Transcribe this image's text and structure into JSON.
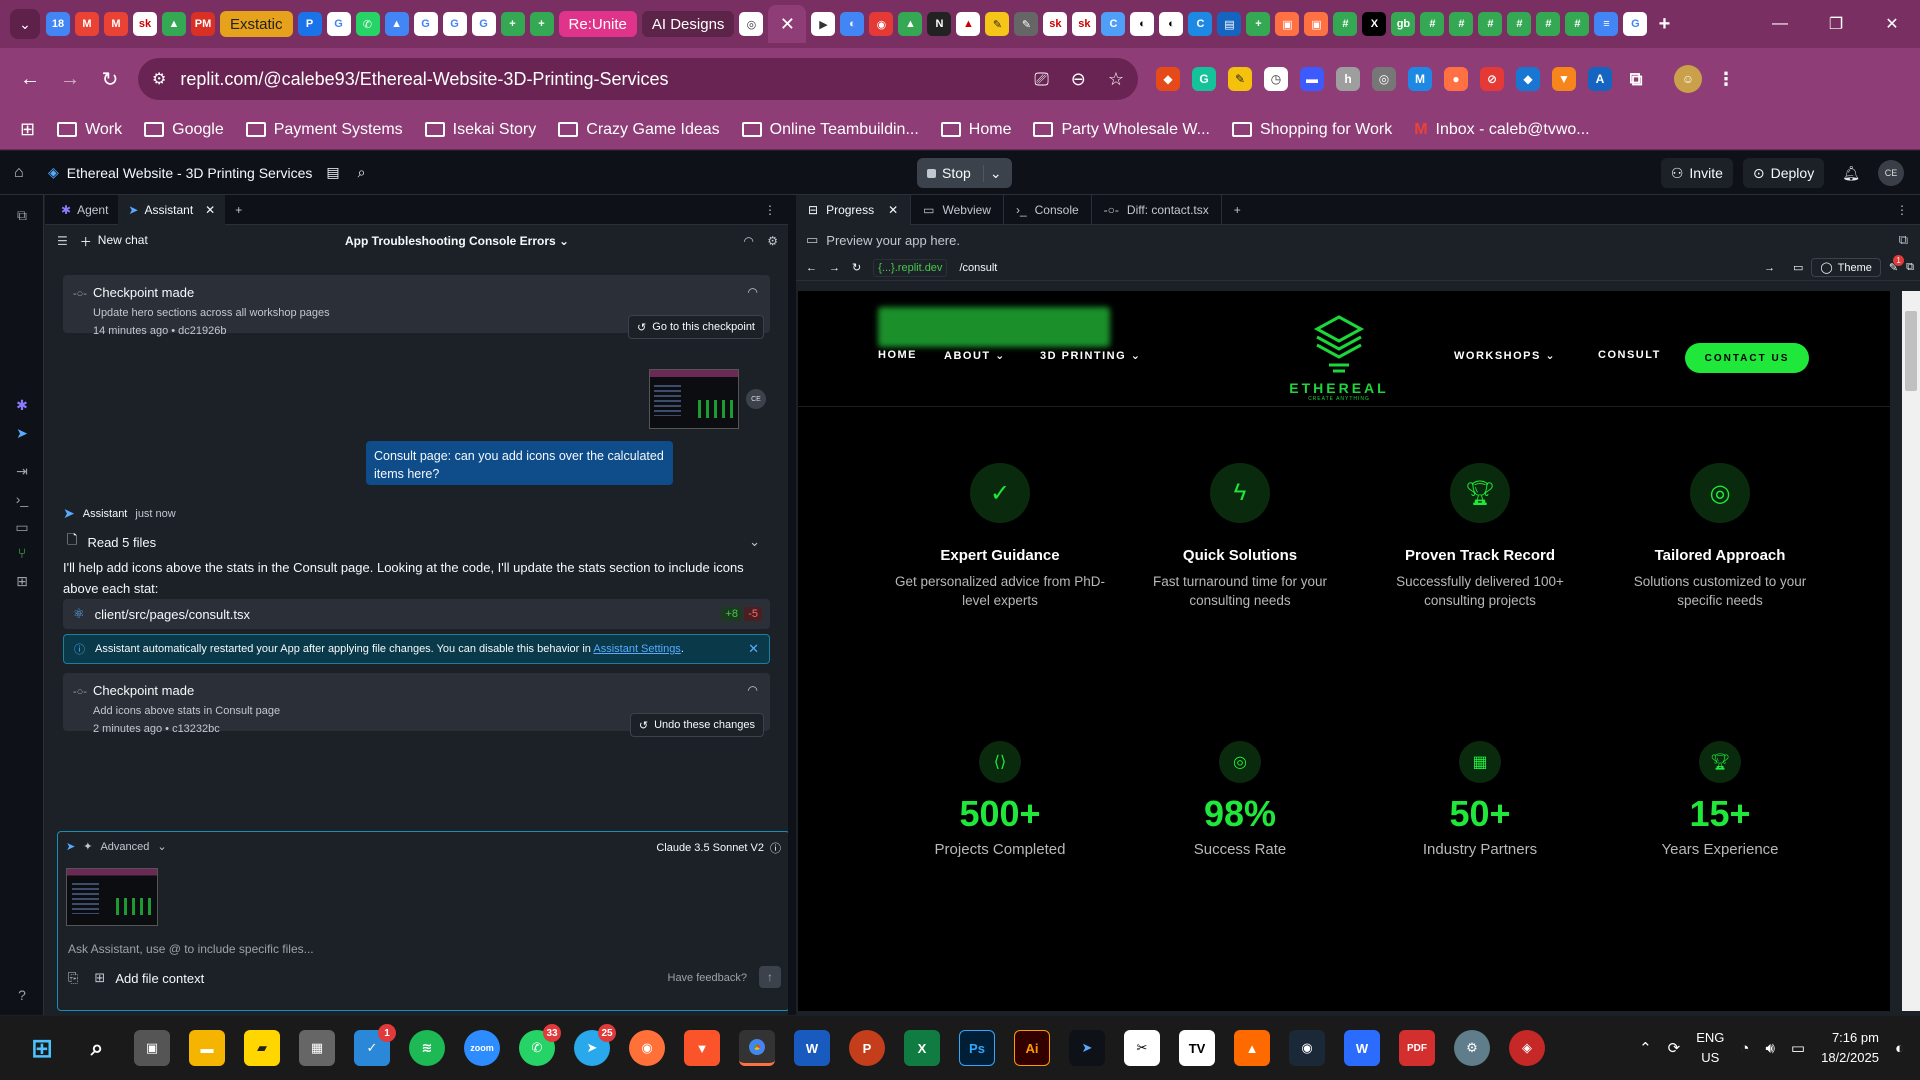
{
  "browser": {
    "tabs_pills": [
      "Exstatic",
      "Re:Unite",
      "AI Designs"
    ],
    "url": "replit.com/@calebe93/Ethereal-Website-3D-Printing-Services",
    "bookmarks": [
      "Work",
      "Google",
      "Payment Systems",
      "Isekai Story",
      "Crazy Game Ideas",
      "Online Teambuildin...",
      "Home",
      "Party Wholesale W...",
      "Shopping for Work",
      "Inbox - caleb@tvwo..."
    ]
  },
  "replit": {
    "project_name": "Ethereal Website - 3D Printing Services",
    "stop_label": "Stop",
    "invite_label": "Invite",
    "deploy_label": "Deploy",
    "avatar_initials": "CE"
  },
  "assistant_pane": {
    "tabs": [
      "Agent",
      "Assistant"
    ],
    "new_chat": "New chat",
    "chat_title": "App Troubleshooting Console Errors",
    "checkpoint1": {
      "title": "Checkpoint made",
      "desc": "Update hero sections across all workshop pages",
      "meta": "14 minutes ago  •  dc21926b",
      "button": "Go to this checkpoint"
    },
    "user_message": "Consult page: can you add icons over the calculated items here?",
    "assistant_name": "Assistant",
    "assistant_time": "just now",
    "read_files": "Read 5 files",
    "reply": "I'll help add icons above the stats in the Consult page. Looking at the code, I'll update the stats section to include icons above each stat:",
    "file_path": "client/src/pages/consult.tsx",
    "additions": "+8",
    "deletions": "-5",
    "info_text": "Assistant automatically restarted your App after applying file changes. You can disable this behavior in",
    "info_link": "Assistant Settings",
    "checkpoint2": {
      "title": "Checkpoint made",
      "desc": "Add icons above stats in Consult page",
      "meta": "2 minutes ago  •  c13232bc",
      "button": "Undo these changes"
    },
    "composer": {
      "advanced": "Advanced",
      "model": "Claude 3.5 Sonnet V2",
      "placeholder": "Ask Assistant, use @ to include specific files...",
      "add_file_context": "Add file context",
      "feedback": "Have feedback?"
    }
  },
  "right_pane": {
    "tabs": [
      "Progress",
      "Webview",
      "Console",
      "Diff: contact.tsx"
    ],
    "preview_label": "Preview your app here.",
    "domain": "{...}.replit.dev",
    "path": "/consult",
    "theme_label": "Theme",
    "notif_count": "1"
  },
  "site": {
    "nav": [
      "HOME",
      "ABOUT",
      "3D PRINTING",
      "WORKSHOPS",
      "CONSULT"
    ],
    "logo_word": "ETHEREAL",
    "logo_tag": "CREATE ANYTHING",
    "contact_btn": "CONTACT US",
    "features": [
      {
        "icon": "check-circle-icon",
        "title": "Expert Guidance",
        "desc": "Get personalized advice from PhD-level experts"
      },
      {
        "icon": "lightning-icon",
        "title": "Quick Solutions",
        "desc": "Fast turnaround time for your consulting needs"
      },
      {
        "icon": "trophy-icon",
        "title": "Proven Track Record",
        "desc": "Successfully delivered 100+ consulting projects"
      },
      {
        "icon": "target-icon",
        "title": "Tailored Approach",
        "desc": "Solutions customized to your specific needs"
      }
    ],
    "stats": [
      {
        "icon": "code-file-icon",
        "value": "500+",
        "label": "Projects Completed"
      },
      {
        "icon": "target-icon",
        "value": "98%",
        "label": "Success Rate"
      },
      {
        "icon": "building-icon",
        "value": "50+",
        "label": "Industry Partners"
      },
      {
        "icon": "trophy-icon",
        "value": "15+",
        "label": "Years Experience"
      }
    ]
  },
  "taskbar": {
    "badges": {
      "todo": "1",
      "whatsapp": "33",
      "telegram": "25"
    },
    "lang": "ENG",
    "region": "US",
    "time": "7:16 pm",
    "date": "18/2/2025"
  },
  "colors": {
    "accent_green": "#1fe83b",
    "browser_purple": "#8f3d77",
    "replit_bg": "#1c2128"
  }
}
